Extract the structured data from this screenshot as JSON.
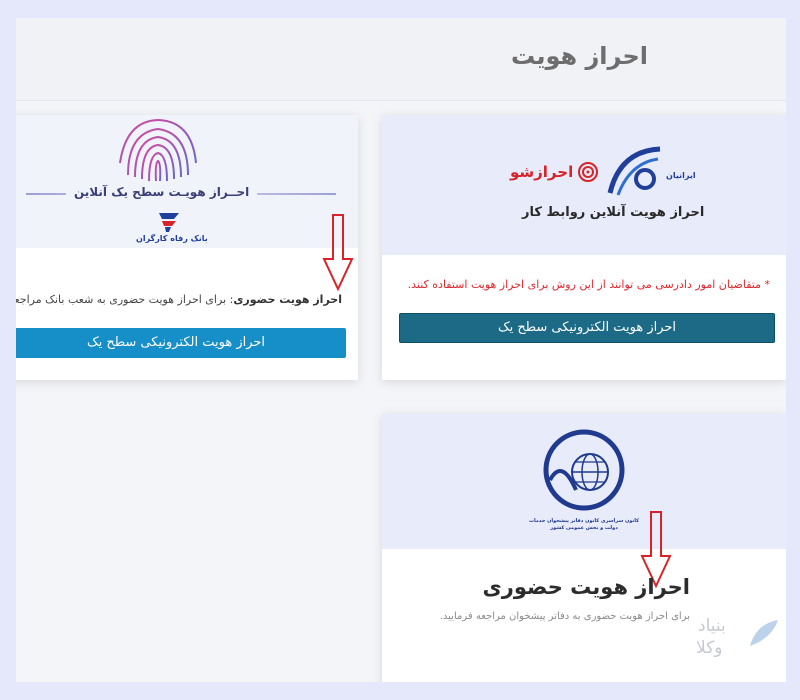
{
  "header": {
    "title": "احراز هویت"
  },
  "card_ehraz": {
    "logo_text_1": "ایرانیان",
    "logo_text_2": "احرازشو",
    "banner_caption": "احراز هویت آنلاین روابط کار",
    "notice": "* متقاضیان امور دادرسی می توانند از این روش برای احراز هویت استفاده کنند.",
    "button_label": "احراز هویت الکترونیکی سطح یک",
    "colors": {
      "button": "#1d6a86",
      "notice": "#e0282e"
    }
  },
  "card_bank": {
    "banner_title": "احــراز هویـت سطح یک آنلاین",
    "bank_name": "بانک رفاه کارگران",
    "note_bold": "احراز هویت حضوری",
    "note_rest": ": برای احراز هویت حضوری به شعب بانک مراجعه فرمایید.",
    "button_label": "احراز هویت الکترونیکی سطح یک",
    "colors": {
      "button": "#168ec7"
    }
  },
  "card_pishkhan": {
    "logo_caption": "کانون سراسری کانون دفاتر پیشخوان خدمات دولت و بخش عمومی کشور",
    "heading": "احراز هویت حضوری",
    "description": "برای احراز هویت حضوری به دفاتر پیشخوان مراجعه فرمایید."
  },
  "watermark": {
    "line1": "بنیاد",
    "line2": "وکلا"
  }
}
